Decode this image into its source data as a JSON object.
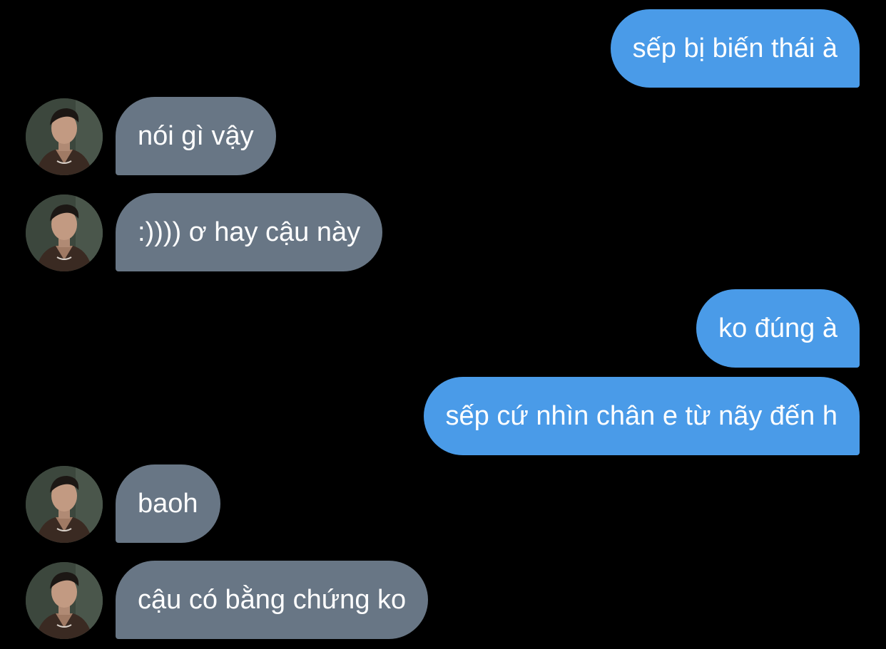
{
  "conversation": {
    "messages": [
      {
        "sender": "me",
        "text": "sếp bị biến thái à"
      },
      {
        "sender": "contact",
        "text": "nói gì vậy"
      },
      {
        "sender": "contact",
        "text": ":)))) ơ hay cậu này"
      },
      {
        "sender": "me",
        "text": "ko đúng à"
      },
      {
        "sender": "me",
        "text": "sếp cứ nhìn chân e từ nãy đến h"
      },
      {
        "sender": "contact",
        "text": "baoh"
      },
      {
        "sender": "contact",
        "text": "cậu có bằng chứng ko"
      }
    ]
  },
  "colors": {
    "background": "#000000",
    "sent_bubble": "#4a9be8",
    "received_bubble": "#687685",
    "text": "#ffffff"
  },
  "icons": {
    "avatar": "contact-avatar-photo"
  }
}
